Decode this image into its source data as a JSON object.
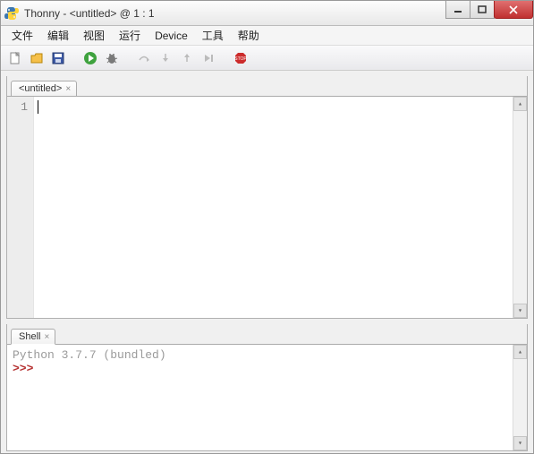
{
  "window": {
    "title": "Thonny  -  <untitled>  @  1 : 1"
  },
  "menu": {
    "items": [
      "文件",
      "编辑",
      "视图",
      "运行",
      "Device",
      "工具",
      "帮助"
    ]
  },
  "toolbar": {
    "icons": [
      "new-file-icon",
      "open-file-icon",
      "save-icon",
      "run-icon",
      "debug-icon",
      "step-over-icon",
      "step-into-icon",
      "step-out-icon",
      "resume-icon",
      "stop-icon"
    ]
  },
  "editor": {
    "tab_label": "<untitled>",
    "line_numbers": [
      "1"
    ],
    "content": ""
  },
  "shell": {
    "tab_label": "Shell",
    "banner": "Python 3.7.7 (bundled)",
    "prompt": ">>>"
  }
}
